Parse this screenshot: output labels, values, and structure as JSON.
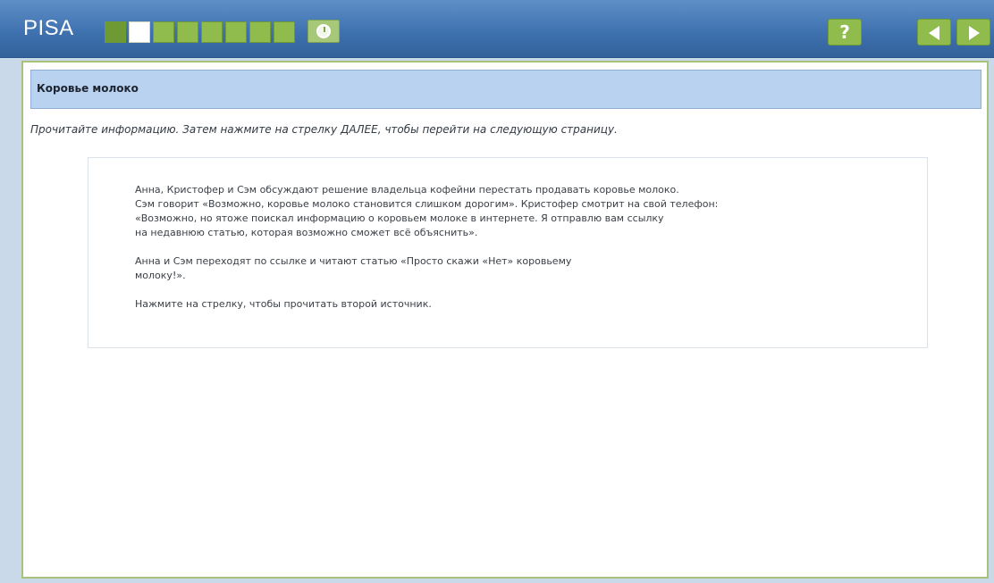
{
  "app": {
    "title": "PISA"
  },
  "toolbar": {
    "progress_segments": [
      "done",
      "current",
      "todo",
      "todo",
      "todo",
      "todo",
      "todo",
      "todo"
    ],
    "timer_icon": "clock-icon",
    "help_label": "?",
    "prev_icon": "arrow-left-icon",
    "next_icon": "arrow-right-icon",
    "accent_green": "#8fbc4c",
    "bar_blue": "#3f72b0"
  },
  "unit": {
    "title": "Коровье молоко",
    "instruction": "Прочитайте информацию. Затем нажмите на стрелку ДАЛЕЕ, чтобы перейти на следующую страницу."
  },
  "stimulus": {
    "paragraph_1": "Анна, Кристофер и Сэм обсуждают решение владельца кофейни перестать продавать коровье молоко.\nСэм говорит «Возможно, коровье молоко становится слишком дорогим». Кристофер смотрит на свой телефон:\n«Возможно, но ятоже поискал информацию о коровьем молоке в интернете. Я отправлю вам ссылку\nна недавнюю статью, которая возможно сможет всё объяснить».",
    "paragraph_2": "Анна и Сэм переходят по ссылке и читают статью «Просто скажи «Нет» коровьему\nмолоку!».",
    "paragraph_3": "Нажмите на стрелку, чтобы прочитать второй источник."
  }
}
